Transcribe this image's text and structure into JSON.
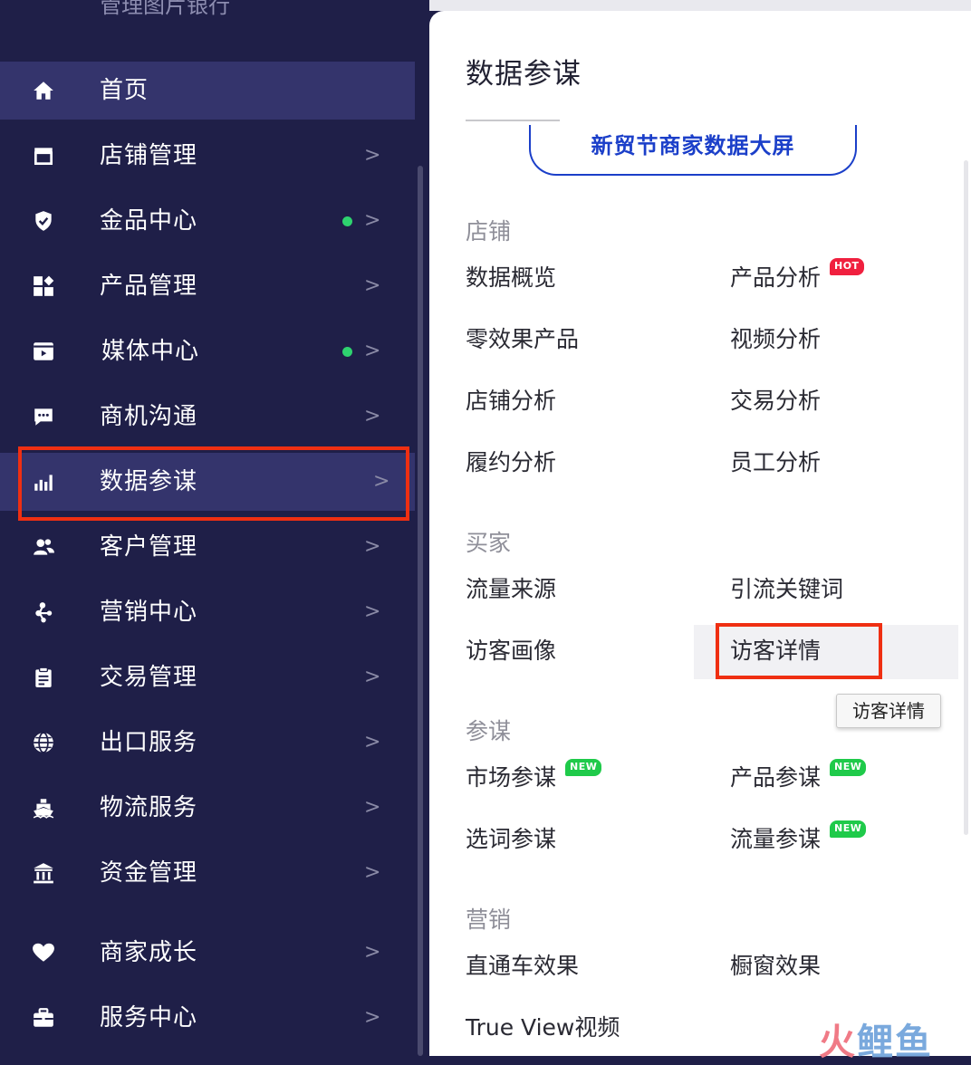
{
  "sidebar": {
    "top_cut_text": "管理图片银行",
    "items": [
      {
        "label": "首页",
        "icon": "home-icon",
        "arrow": "",
        "dot": false,
        "active": true
      },
      {
        "label": "店铺管理",
        "icon": "store-icon",
        "arrow": ">",
        "dot": false
      },
      {
        "label": "金品中心",
        "icon": "shield-icon",
        "arrow": ">",
        "dot": true
      },
      {
        "label": "产品管理",
        "icon": "grid-icon",
        "arrow": ">",
        "dot": false
      },
      {
        "label": "媒体中心",
        "icon": "video-icon",
        "arrow": ">",
        "dot": true
      },
      {
        "label": "商机沟通",
        "icon": "chat-icon",
        "arrow": ">",
        "dot": false
      },
      {
        "label": "数据参谋",
        "icon": "bar-chart-icon",
        "arrow": ">",
        "dot": false,
        "highlighted": true
      },
      {
        "label": "客户管理",
        "icon": "users-icon",
        "arrow": ">",
        "dot": false
      },
      {
        "label": "营销中心",
        "icon": "share-icon",
        "arrow": ">",
        "dot": false
      },
      {
        "label": "交易管理",
        "icon": "clipboard-icon",
        "arrow": ">",
        "dot": false
      },
      {
        "label": "出口服务",
        "icon": "globe-icon",
        "arrow": ">",
        "dot": false
      },
      {
        "label": "物流服务",
        "icon": "ship-icon",
        "arrow": ">",
        "dot": false
      },
      {
        "label": "资金管理",
        "icon": "bank-icon",
        "arrow": ">",
        "dot": false
      },
      {
        "label": "商家成长",
        "icon": "heart-icon",
        "arrow": ">",
        "dot": false
      },
      {
        "label": "服务中心",
        "icon": "briefcase-icon",
        "arrow": ">",
        "dot": false
      }
    ]
  },
  "panel": {
    "title": "数据参谋",
    "big_button": "新贸节商家数据大屏",
    "sections": {
      "store": {
        "title": "店铺",
        "links": [
          "数据概览",
          "产品分析",
          "零效果产品",
          "视频分析",
          "店铺分析",
          "交易分析",
          "履约分析",
          "员工分析"
        ]
      },
      "buyer": {
        "title": "买家",
        "links": [
          "流量来源",
          "引流关键词",
          "访客画像",
          "访客详情"
        ]
      },
      "advisor": {
        "title": "参谋",
        "links": [
          "市场参谋",
          "产品参谋",
          "选词参谋",
          "流量参谋"
        ]
      },
      "marketing": {
        "title": "营销",
        "links": [
          "直通车效果",
          "橱窗效果",
          "True View视频"
        ]
      }
    },
    "badges": {
      "hot": "HOT",
      "new": "NEW"
    },
    "tooltip": "访客详情"
  },
  "watermark": {
    "part1": "火",
    "part2": "鲤鱼"
  },
  "colors": {
    "sidebar_bg": "#1f1f48",
    "active_bg": "#34346c",
    "highlight_red": "#ef2f12",
    "accent_blue": "#1b3fc9",
    "dot_green": "#2ed36f",
    "hot_red": "#f0203f",
    "new_green": "#1fca4a"
  }
}
